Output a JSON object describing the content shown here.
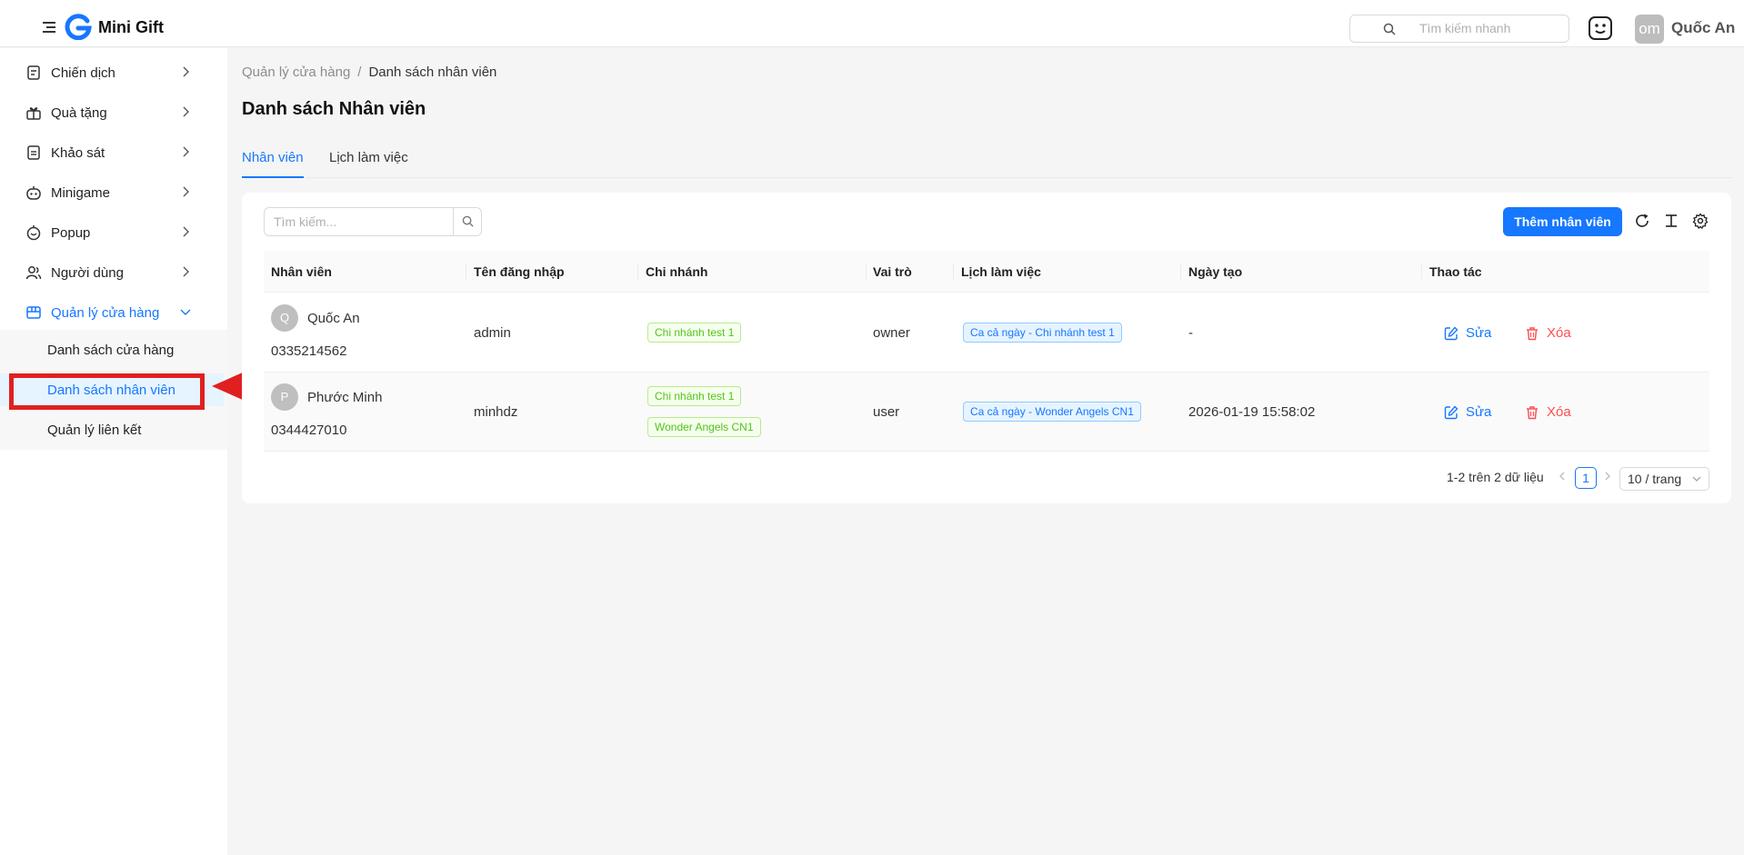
{
  "header": {
    "app_title": "Mini Gift",
    "search_placeholder": "Tìm kiếm nhanh",
    "avatar_initials": "om",
    "user_name": "Quốc An"
  },
  "sidebar": {
    "items": [
      {
        "label": "Chiến dịch",
        "icon": "campaign-icon"
      },
      {
        "label": "Quà tặng",
        "icon": "gift-icon"
      },
      {
        "label": "Khảo sát",
        "icon": "survey-icon"
      },
      {
        "label": "Minigame",
        "icon": "robot-icon"
      },
      {
        "label": "Popup",
        "icon": "popup-icon"
      },
      {
        "label": "Người dùng",
        "icon": "users-icon"
      },
      {
        "label": "Quản lý cửa hàng",
        "icon": "store-icon"
      }
    ],
    "subitems": [
      {
        "label": "Danh sách cửa hàng"
      },
      {
        "label": "Danh sách nhân viên"
      },
      {
        "label": "Quản lý liên kết"
      }
    ]
  },
  "breadcrumb": {
    "parent": "Quản lý cửa hàng",
    "separator": "/",
    "current": "Danh sách nhân viên"
  },
  "page_title": "Danh sách Nhân viên",
  "tabs": [
    {
      "label": "Nhân viên"
    },
    {
      "label": "Lịch làm việc"
    }
  ],
  "toolbar": {
    "search_placeholder": "Tìm kiếm...",
    "add_label": "Thêm nhân viên"
  },
  "table": {
    "columns": [
      "Nhân viên",
      "Tên đăng nhập",
      "Chi nhánh",
      "Vai trò",
      "Lịch làm việc",
      "Ngày tạo",
      "Thao tác"
    ],
    "rows": [
      {
        "initial": "Q",
        "name": "Quốc An",
        "phone": "0335214562",
        "username": "admin",
        "branches": [
          "Chi nhánh test 1"
        ],
        "role": "owner",
        "schedule": "Ca cả ngày - Chi nhánh test 1",
        "created": "-",
        "edit": "Sửa",
        "delete": "Xóa"
      },
      {
        "initial": "P",
        "name": "Phước Minh",
        "phone": "0344427010",
        "username": "minhdz",
        "branches": [
          "Chi nhánh test 1",
          "Wonder Angels CN1"
        ],
        "role": "user",
        "schedule": "Ca cả ngày - Wonder Angels CN1",
        "created": "2026-01-19 15:58:02",
        "edit": "Sửa",
        "delete": "Xóa"
      }
    ]
  },
  "pagination": {
    "total_text": "1-2 trên 2 dữ liệu",
    "current_page": "1",
    "page_size": "10 / trang"
  },
  "colors": {
    "primary": "#1677ff",
    "danger": "#ff4d4f",
    "annotation": "#e02020"
  }
}
